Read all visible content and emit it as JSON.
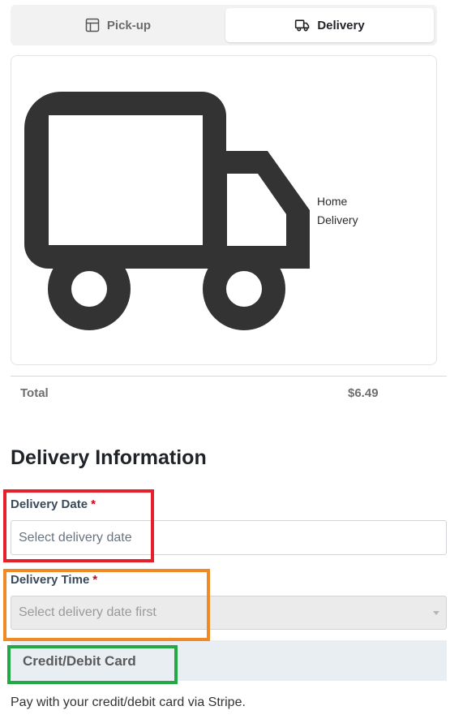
{
  "tabs": [
    {
      "label": "Pick-up",
      "icon": "store-layout-icon",
      "active": false
    },
    {
      "label": "Delivery",
      "icon": "truck-icon",
      "active": true
    }
  ],
  "option_card": {
    "icon": "truck-icon",
    "label_line1": "Home",
    "label_line2": "Delivery"
  },
  "summary": {
    "total_label": "Total",
    "total_value": "$6.49"
  },
  "delivery_info": {
    "title": "Delivery Information",
    "date_label": "Delivery Date",
    "date_placeholder": "Select delivery date",
    "time_label": "Delivery Time",
    "time_placeholder": "Select delivery date first",
    "required_mark": "*"
  },
  "payment": {
    "method_label": "Credit/Debit Card",
    "description": "Pay with your credit/debit card via Stripe."
  },
  "annotation_colors": {
    "red": "#e5202a",
    "orange": "#f08a24",
    "green": "#22a845"
  }
}
